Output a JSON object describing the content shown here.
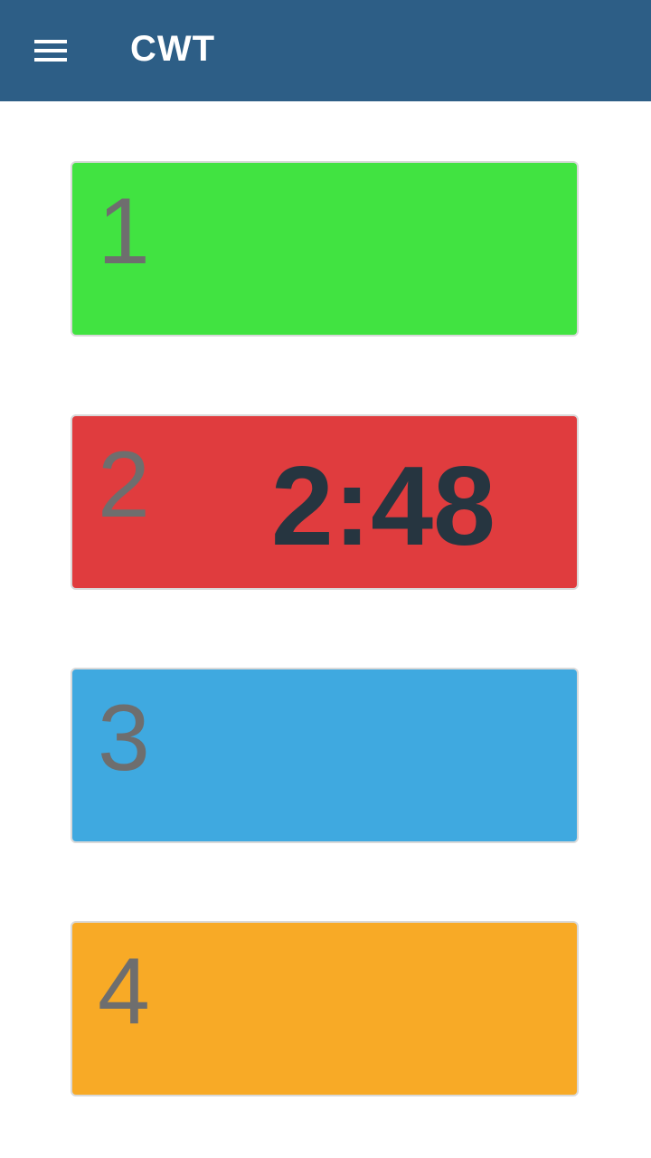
{
  "app_bar": {
    "title": "CWT",
    "menu_icon": "hamburger-menu-icon",
    "background": "#2d5e86"
  },
  "timers": [
    {
      "number": "1",
      "time": "",
      "color": "#41e341"
    },
    {
      "number": "2",
      "time": "2:48",
      "color": "#e03c3e"
    },
    {
      "number": "3",
      "time": "",
      "color": "#3fa9e0"
    },
    {
      "number": "4",
      "time": "",
      "color": "#f8aa26"
    }
  ]
}
